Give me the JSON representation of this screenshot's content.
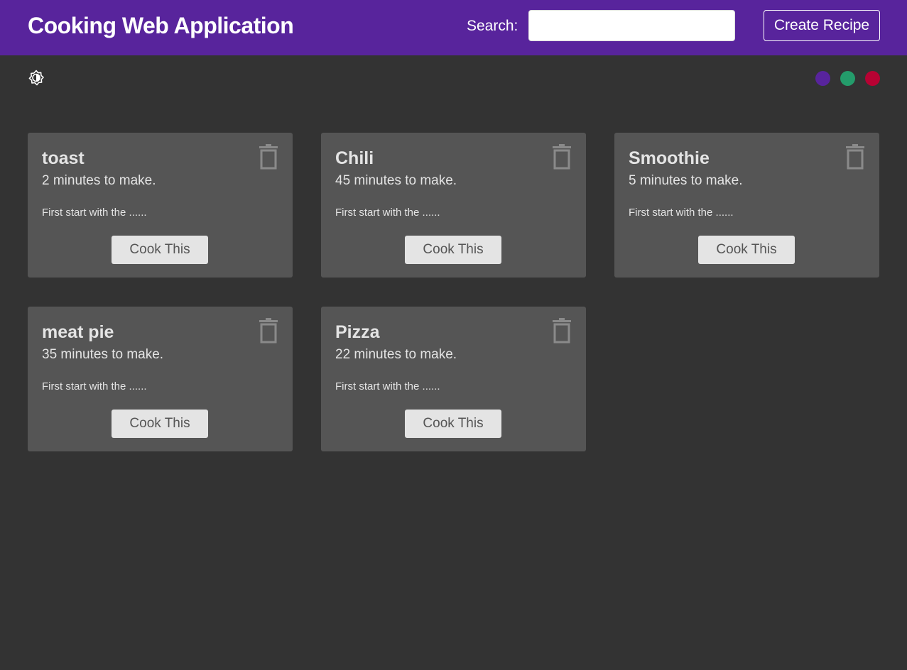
{
  "navbar": {
    "title": "Cooking Web Application",
    "search_label": "Search:",
    "search_value": "",
    "search_placeholder": "",
    "create_label": "Create Recipe"
  },
  "theme": {
    "mode_icon": "brightness-icon",
    "colors": [
      "#58249c",
      "#249c6b",
      "#b70233"
    ]
  },
  "recipes": [
    {
      "title": "toast",
      "time": "2 minutes to make.",
      "method": "First start with the ......",
      "button": "Cook This"
    },
    {
      "title": "Chili",
      "time": "45 minutes to make.",
      "method": "First start with the ......",
      "button": "Cook This"
    },
    {
      "title": "Smoothie",
      "time": "5 minutes to make.",
      "method": "First start with the ......",
      "button": "Cook This"
    },
    {
      "title": "meat pie",
      "time": "35 minutes to make.",
      "method": "First start with the ......",
      "button": "Cook This"
    },
    {
      "title": "Pizza",
      "time": "22 minutes to make.",
      "method": "First start with the ......",
      "button": "Cook This"
    }
  ],
  "icons": {
    "delete": "trash-icon"
  }
}
